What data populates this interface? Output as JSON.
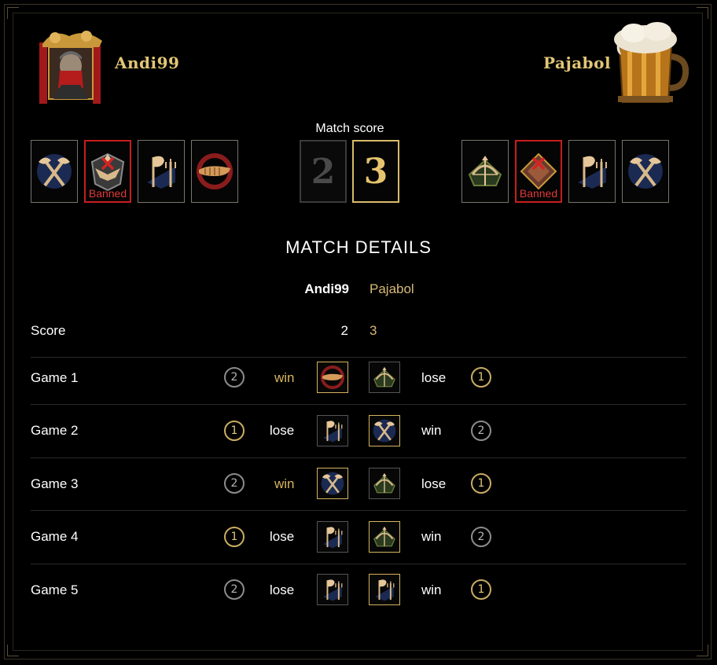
{
  "players": {
    "left": {
      "name": "Andi99",
      "avatar": "red-masked-warrior-portrait"
    },
    "right": {
      "name": "Pajabol",
      "avatar": "beer-mug-portrait"
    }
  },
  "match": {
    "score_label": "Match score",
    "left_score": "2",
    "right_score": "3",
    "banned_label": "Banned"
  },
  "left_civs": [
    {
      "icon": "crossed-axes-icon",
      "banned": false
    },
    {
      "icon": "winged-eagle-icon",
      "banned": true
    },
    {
      "icon": "flag-trident-icon",
      "banned": false
    },
    {
      "icon": "horn-icon",
      "banned": false
    }
  ],
  "right_civs": [
    {
      "icon": "bow-arrow-icon",
      "banned": false
    },
    {
      "icon": "diamond-shield-icon",
      "banned": true
    },
    {
      "icon": "flag-trident-icon",
      "banned": false
    },
    {
      "icon": "crossed-axes-icon",
      "banned": false
    }
  ],
  "details": {
    "title": "MATCH DETAILS",
    "header_left": "Andi99",
    "header_right": "Pajabol",
    "score_label": "Score",
    "score_left": "2",
    "score_right": "3"
  },
  "games": [
    {
      "label": "Game 1",
      "left_coin": "2",
      "left_result": "win",
      "left_civ": "horn-icon",
      "right_civ": "bow-arrow-icon",
      "right_result": "lose",
      "right_coin": "1"
    },
    {
      "label": "Game 2",
      "left_coin": "1",
      "left_result": "lose",
      "left_civ": "flag-trident-icon",
      "right_civ": "crossed-axes-icon",
      "right_result": "win",
      "right_coin": "2"
    },
    {
      "label": "Game 3",
      "left_coin": "2",
      "left_result": "win",
      "left_civ": "crossed-axes-icon",
      "right_civ": "bow-arrow-icon",
      "right_result": "lose",
      "right_coin": "1"
    },
    {
      "label": "Game 4",
      "left_coin": "1",
      "left_result": "lose",
      "left_civ": "flag-trident-icon",
      "right_civ": "bow-arrow-icon",
      "right_result": "win",
      "right_coin": "2"
    },
    {
      "label": "Game 5",
      "left_coin": "2",
      "left_result": "lose",
      "left_civ": "flag-trident-icon",
      "right_civ": "flag-trident-icon",
      "right_result": "win",
      "right_coin": "1"
    }
  ],
  "colors": {
    "gold": "#d8b560",
    "banned_red": "#c61d1d",
    "background": "#000000"
  }
}
